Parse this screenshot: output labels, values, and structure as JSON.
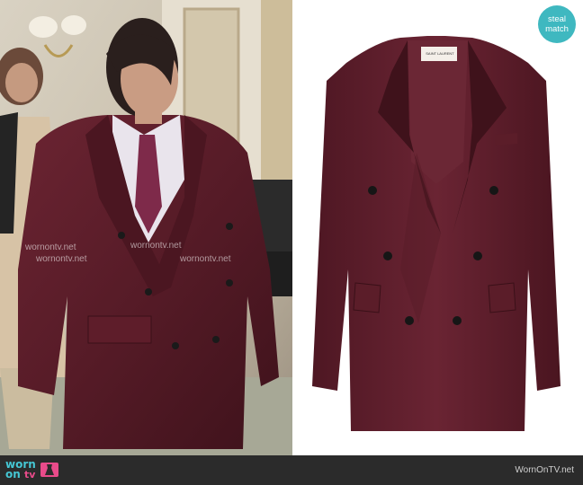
{
  "badge": {
    "line1": "steal",
    "line2": "match"
  },
  "watermarks": [
    "wornontv.net",
    "wornontv.net",
    "wornontv.net",
    "wornontv.net"
  ],
  "blazer_label": "SAINT LAURENT",
  "footer": {
    "logo_worn": "worn",
    "logo_on": "on",
    "logo_tv": "tv",
    "site": "WornOnTV.net"
  },
  "colors": {
    "suit": "#5a1c28",
    "badge": "#3fb8c0",
    "footer": "#2b2b2b"
  }
}
